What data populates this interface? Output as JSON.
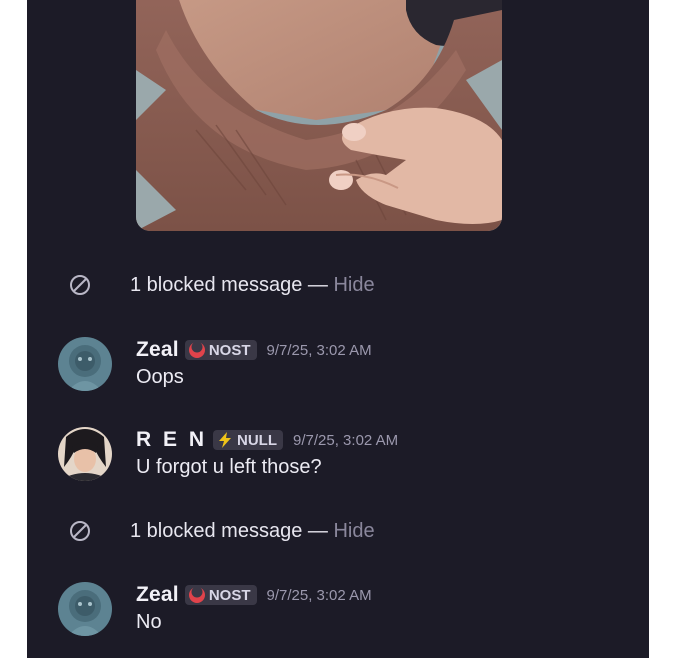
{
  "blocked": [
    {
      "label": "1 blocked message",
      "separator": " — ",
      "action": "Hide"
    },
    {
      "label": "1 blocked message",
      "separator": " — ",
      "action": "Hide"
    }
  ],
  "messages": [
    {
      "username": "Zeal",
      "tag": "NOST",
      "tag_icon": "red-crescent-icon",
      "timestamp": "9/7/25, 3:02 AM",
      "text": "Oops"
    },
    {
      "username": "R E N",
      "tag": "NULL",
      "tag_icon": "lightning-bolt-icon",
      "timestamp": "9/7/25, 3:02 AM",
      "text": "U forgot u left those?"
    },
    {
      "username": "Zeal",
      "tag": "NOST",
      "tag_icon": "red-crescent-icon",
      "timestamp": "9/7/25, 3:02 AM",
      "text": "No"
    }
  ],
  "colors": {
    "background": "#1c1b27",
    "text": "#ecebf3",
    "muted": "#9b98ad",
    "tag_bg": "#3a3846",
    "nost_icon": "#e0434b",
    "null_icon": "#f0c419"
  }
}
